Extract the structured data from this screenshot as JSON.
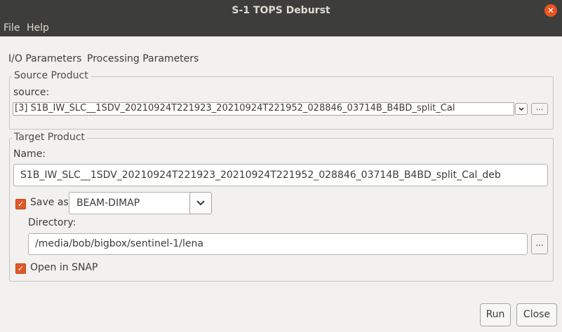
{
  "window": {
    "title": "S-1 TOPS Deburst"
  },
  "menu": {
    "file": "File",
    "help": "Help"
  },
  "tabs": {
    "io": "I/O Parameters",
    "processing": "Processing Parameters"
  },
  "source_product": {
    "legend": "Source Product",
    "source_label": "source:",
    "source_value": "[3] S1B_IW_SLC__1SDV_20210924T221923_20210924T221952_028846_03714B_B4BD_split_Cal",
    "browse_label": "..."
  },
  "target_product": {
    "legend": "Target Product",
    "name_label": "Name:",
    "name_value": "S1B_IW_SLC__1SDV_20210924T221923_20210924T221952_028846_03714B_B4BD_split_Cal_deb",
    "save_as_label": "Save as:",
    "save_as_checked": true,
    "format_value": "BEAM-DIMAP",
    "directory_label": "Directory:",
    "directory_value": "/media/bob/bigbox/sentinel-1/lena",
    "browse_label": "...",
    "open_in_snap_label": "Open in SNAP",
    "open_in_snap_checked": true
  },
  "buttons": {
    "run": "Run",
    "close": "Close"
  },
  "colors": {
    "titlebar": "#3d3d3b",
    "accent": "#e95420",
    "background": "#f2f1f0"
  },
  "icons": {
    "window_close": "close-icon",
    "dropdown": "chevron-down-icon",
    "checkbox": "checkmark-icon"
  }
}
